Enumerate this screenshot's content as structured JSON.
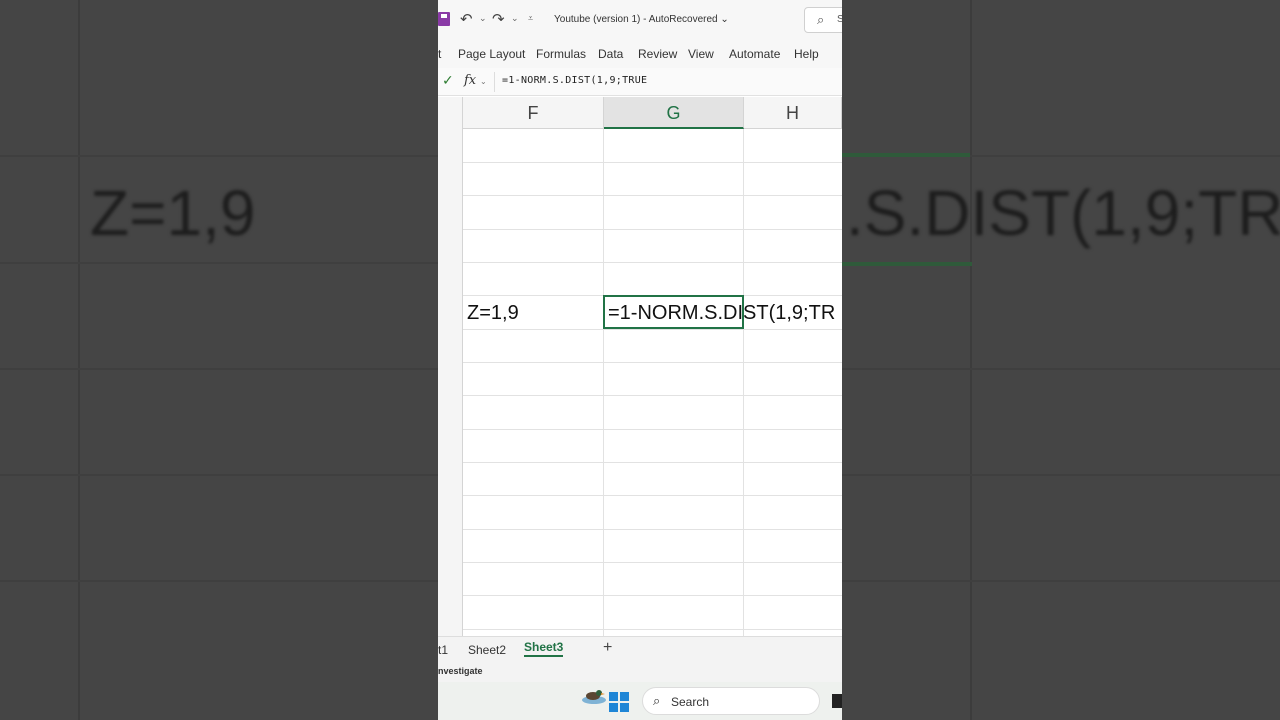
{
  "window": {
    "title": "Youtube (version 1)  -  AutoRecovered",
    "search_partial": "S"
  },
  "ribbon": {
    "tabs": [
      {
        "label": "t"
      },
      {
        "label": "Page Layout"
      },
      {
        "label": "Formulas"
      },
      {
        "label": "Data"
      },
      {
        "label": "Review"
      },
      {
        "label": "View"
      },
      {
        "label": "Automate"
      },
      {
        "label": "Help"
      }
    ]
  },
  "formula_bar": {
    "fx_label": "fx",
    "formula": "=1-NORM.S.DIST(1,9;TRUE"
  },
  "columns": [
    {
      "label": "F",
      "selected": false
    },
    {
      "label": "G",
      "selected": true
    },
    {
      "label": "H",
      "selected": false
    }
  ],
  "cells": {
    "f_label": "Z=1,9",
    "g_formula": "=1-NORM.S.DIST(1,9;TR"
  },
  "sheets": {
    "tabs": [
      {
        "label": "t1",
        "active": false
      },
      {
        "label": "Sheet2",
        "active": false
      },
      {
        "label": "Sheet3",
        "active": true
      }
    ],
    "add_label": "+"
  },
  "status": {
    "text": "nvestigate"
  },
  "taskbar": {
    "search_label": "Search"
  },
  "background": {
    "left_text": "Z=1,9",
    "right_text": ".S.DIST(1,9;TR"
  },
  "colors": {
    "excel_green": "#217346",
    "accent_purple": "#8a3aa6",
    "windows_blue": "#1f86d6"
  }
}
